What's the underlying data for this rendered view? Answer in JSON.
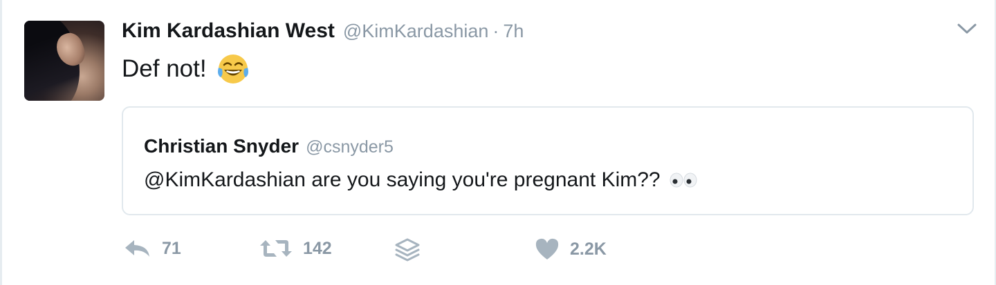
{
  "tweet": {
    "author_name": "Kim Kardashian West",
    "author_handle": "@KimKardashian",
    "separator": "·",
    "time": "7h",
    "text": "Def not!",
    "emoji_icon": "face-with-tears-of-joy-icon"
  },
  "quoted_tweet": {
    "author_name": "Christian Snyder",
    "author_handle": "@csnyder5",
    "text": "@KimKardashian are you saying you're pregnant Kim??",
    "emoji_icon": "eyes-icon"
  },
  "actions": {
    "reply_count": "71",
    "retweet_count": "142",
    "like_count": "2.2K"
  },
  "colors": {
    "text": "#14171a",
    "secondary": "#8a98a5",
    "border": "#e1e8ed"
  }
}
